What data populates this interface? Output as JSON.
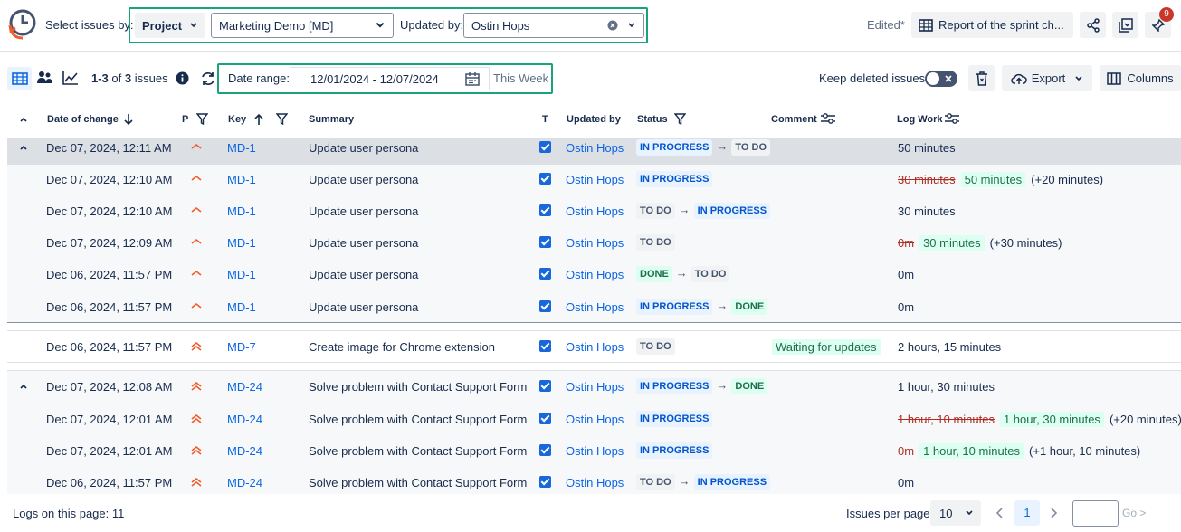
{
  "topbar": {
    "select_label": "Select issues by:",
    "project_btn": "Project",
    "project_value": "Marketing Demo [MD]",
    "updated_by_label": "Updated by:",
    "updated_by_value": "Ostin Hops",
    "edited_label": "Edited*",
    "report_title": "Report of the sprint ch...",
    "notification_count": "9"
  },
  "toolbar": {
    "issue_count_range": "1-3",
    "issue_count_of": "of",
    "issue_count_total": "3",
    "issue_count_suffix": "issues",
    "date_range_label": "Date range:",
    "date_range_value": "12/01/2024 - 12/07/2024",
    "date_preset": "This Week",
    "keep_deleted_label": "Keep deleted issues",
    "export_label": "Export",
    "columns_label": "Columns"
  },
  "columns": {
    "date": "Date of change",
    "priority": "P",
    "key": "Key",
    "summary": "Summary",
    "type": "T",
    "updated_by": "Updated by",
    "status": "Status",
    "comment": "Comment",
    "log_work": "Log Work"
  },
  "rows": [
    {
      "date": "Dec 07, 2024, 12:11 AM",
      "key": "MD-1",
      "summary": "Update user persona",
      "user": "Ostin Hops",
      "from": "IN PROGRESS",
      "to": "TO DO",
      "log": "50 minutes"
    },
    {
      "date": "Dec 07, 2024, 12:10 AM",
      "key": "MD-1",
      "summary": "Update user persona",
      "user": "Ostin Hops",
      "status": "IN PROGRESS",
      "log_old": "30 minutes",
      "log_new": "50 minutes",
      "log_diff": "(+20 minutes)"
    },
    {
      "date": "Dec 07, 2024, 12:10 AM",
      "key": "MD-1",
      "summary": "Update user persona",
      "user": "Ostin Hops",
      "from": "TO DO",
      "to": "IN PROGRESS",
      "log": "30 minutes"
    },
    {
      "date": "Dec 07, 2024, 12:09 AM",
      "key": "MD-1",
      "summary": "Update user persona",
      "user": "Ostin Hops",
      "status": "TO DO",
      "log_old": "0m",
      "log_new": "30 minutes",
      "log_diff": "(+30 minutes)"
    },
    {
      "date": "Dec 06, 2024, 11:57 PM",
      "key": "MD-1",
      "summary": "Update user persona",
      "user": "Ostin Hops",
      "from": "DONE",
      "to": "TO DO",
      "log": "0m"
    },
    {
      "date": "Dec 06, 2024, 11:57 PM",
      "key": "MD-1",
      "summary": "Update user persona",
      "user": "Ostin Hops",
      "from": "IN PROGRESS",
      "to": "DONE",
      "log": "0m"
    },
    {
      "date": "Dec 06, 2024, 11:57 PM",
      "key": "MD-7",
      "summary": "Create image for Chrome extension",
      "user": "Ostin Hops",
      "status": "TO DO",
      "comment": "Waiting for updates",
      "log": "2 hours, 15 minutes"
    },
    {
      "date": "Dec 07, 2024, 12:08 AM",
      "key": "MD-24",
      "summary": "Solve problem with Contact Support Form",
      "user": "Ostin Hops",
      "from": "IN PROGRESS",
      "to": "DONE",
      "log": "1 hour, 30 minutes"
    },
    {
      "date": "Dec 07, 2024, 12:01 AM",
      "key": "MD-24",
      "summary": "Solve problem with Contact Support Form",
      "user": "Ostin Hops",
      "status": "IN PROGRESS",
      "log_old": "1 hour, 10 minutes",
      "log_new": "1 hour, 30 minutes",
      "log_diff": "(+20 minutes)"
    },
    {
      "date": "Dec 07, 2024, 12:01 AM",
      "key": "MD-24",
      "summary": "Solve problem with Contact Support Form",
      "user": "Ostin Hops",
      "status": "IN PROGRESS",
      "log_old": "0m",
      "log_new": "1 hour, 10 minutes",
      "log_diff": "(+1 hour, 10 minutes)"
    },
    {
      "date": "Dec 06, 2024, 11:57 PM",
      "key": "MD-24",
      "summary": "Solve problem with Contact Support Form",
      "user": "Ostin Hops",
      "from": "TO DO",
      "to": "IN PROGRESS",
      "log": "0m"
    }
  ],
  "footer": {
    "logs_label": "Logs on this page: 11",
    "per_page_label": "Issues per page",
    "per_page_value": "10",
    "current_page": "1",
    "go_label": "Go >"
  },
  "colors": {
    "accent": "#1868db",
    "frame": "#1aa37a",
    "priority": "#f15b2a"
  }
}
